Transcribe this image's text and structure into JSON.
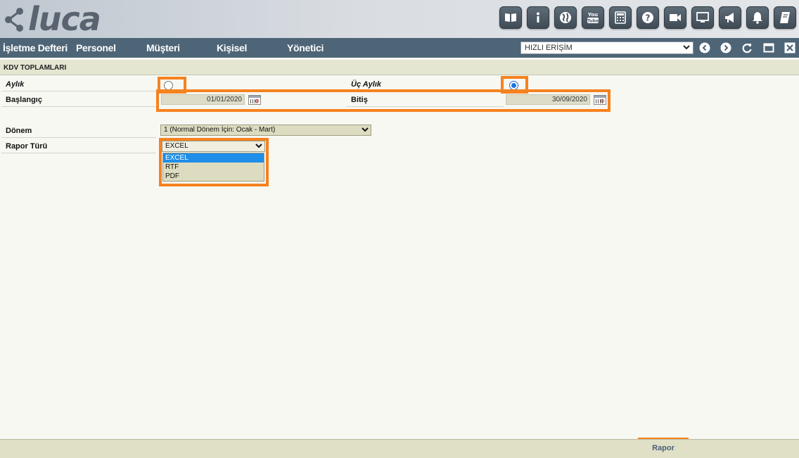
{
  "header": {
    "logo_text": "luca",
    "icons": [
      "book-icon",
      "info-icon",
      "globe-icon",
      "youtube-icon",
      "calculator-icon",
      "help-icon",
      "video-icon",
      "monitor-icon",
      "megaphone-icon",
      "bell-icon",
      "notebook-icon"
    ],
    "youtube_label": "You Tube"
  },
  "menu": {
    "items": [
      "İşletme Defteri",
      "Personel",
      "Müşteri",
      "Kişisel",
      "Yönetici"
    ],
    "quick_access": "HIZLI ERİŞİM"
  },
  "form": {
    "title": "KDV TOPLAMLARI",
    "aylik_label": "Aylık",
    "uc_aylik_label": "Üç Aylık",
    "baslangic_label": "Başlangıç",
    "baslangic_value": "01/01/2020",
    "bitis_label": "Bitiş",
    "bitis_value": "30/09/2020",
    "donem_label": "Dönem",
    "donem_value": "1 (Normal Dönem İçin: Ocak - Mart)",
    "rapor_turu_label": "Rapor Türü",
    "rapor_turu_value": "EXCEL",
    "rapor_turu_options": [
      "EXCEL",
      "RTF",
      "PDF"
    ],
    "selected_period": "Üç Aylık"
  },
  "footer": {
    "rapor_button": "Rapor"
  },
  "colors": {
    "menubar": "#4e6577",
    "highlight": "#f58220",
    "selected_option": "#1e8ee8"
  }
}
